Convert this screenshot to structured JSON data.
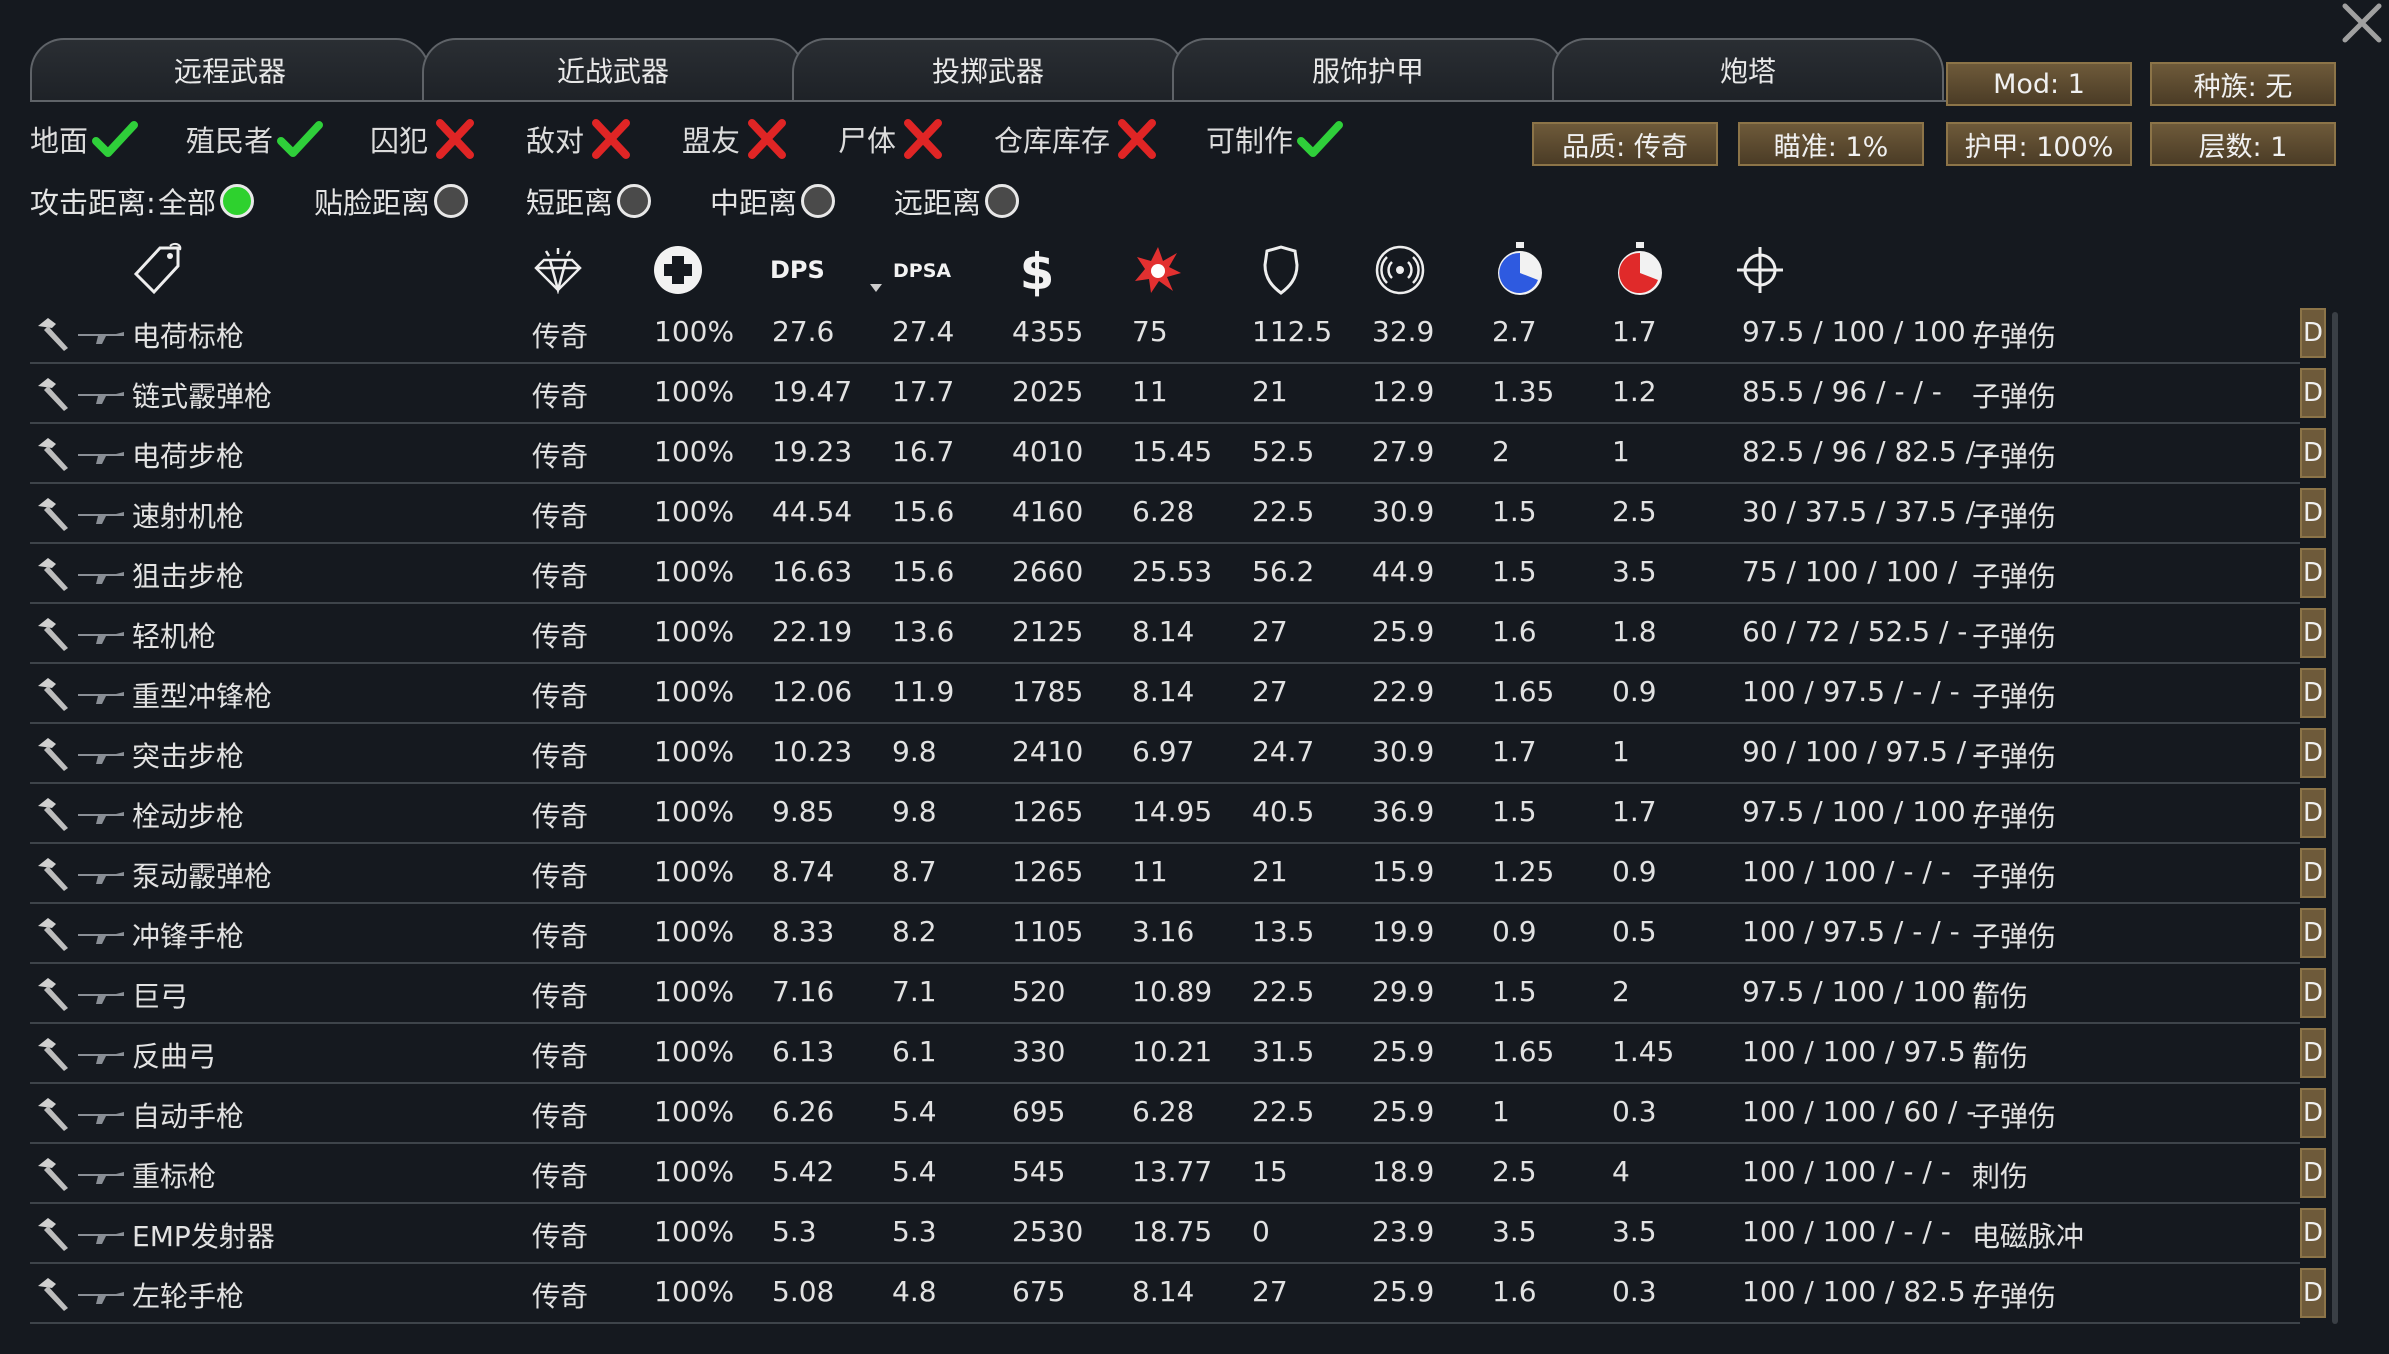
{
  "tabs": [
    "远程武器",
    "近战武器",
    "投掷武器",
    "服饰护甲",
    "炮塔"
  ],
  "right_buttons": {
    "mod": "Mod: 1",
    "race": "种族: 无",
    "quality": "品质: 传奇",
    "aim": "瞄准: 1%",
    "armor": "护甲: 100%",
    "layers": "层数: 1"
  },
  "filters": [
    {
      "label": "地面",
      "state": "check"
    },
    {
      "label": "殖民者",
      "state": "check"
    },
    {
      "label": "囚犯",
      "state": "cross"
    },
    {
      "label": "敌对",
      "state": "cross"
    },
    {
      "label": "盟友",
      "state": "cross"
    },
    {
      "label": "尸体",
      "state": "cross"
    },
    {
      "label": "仓库库存",
      "state": "cross"
    },
    {
      "label": "可制作",
      "state": "check"
    }
  ],
  "range_filter": {
    "prefix": "攻击距离:",
    "options": [
      {
        "label": "全部",
        "on": true
      },
      {
        "label": "贴脸距离",
        "on": false
      },
      {
        "label": "短距离",
        "on": false
      },
      {
        "label": "中距离",
        "on": false
      },
      {
        "label": "远距离",
        "on": false
      }
    ]
  },
  "header": {
    "dps": "DPS",
    "dpsa": "DPSA",
    "icons": [
      "tag-icon",
      "diamond-icon",
      "health-cross-icon",
      "dollar-icon",
      "explosion-icon",
      "shield-icon",
      "range-signal-icon",
      "warmup-timer-icon",
      "cooldown-timer-icon",
      "crosshair-icon"
    ]
  },
  "colors": {
    "check": "#2fcf3a",
    "cross": "#e02525",
    "button": "#6e5a3a"
  },
  "rows": [
    [
      "电荷标枪",
      "传奇",
      "100%",
      "27.6",
      "27.4",
      "4355",
      "75",
      "112.5",
      "32.9",
      "2.7",
      "1.7",
      "97.5 / 100 / 100 /",
      "子弹伤"
    ],
    [
      "链式霰弹枪",
      "传奇",
      "100%",
      "19.47",
      "17.7",
      "2025",
      "11",
      "21",
      "12.9",
      "1.35",
      "1.2",
      "85.5 / 96 / - / -",
      "子弹伤"
    ],
    [
      "电荷步枪",
      "传奇",
      "100%",
      "19.23",
      "16.7",
      "4010",
      "15.45",
      "52.5",
      "27.9",
      "2",
      "1",
      "82.5 / 96 / 82.5 / -",
      "子弹伤"
    ],
    [
      "速射机枪",
      "传奇",
      "100%",
      "44.54",
      "15.6",
      "4160",
      "6.28",
      "22.5",
      "30.9",
      "1.5",
      "2.5",
      "30 / 37.5 / 37.5 / -",
      "子弹伤"
    ],
    [
      "狙击步枪",
      "传奇",
      "100%",
      "16.63",
      "15.6",
      "2660",
      "25.53",
      "56.2",
      "44.9",
      "1.5",
      "3.5",
      "75 / 100 / 100 /",
      "子弹伤"
    ],
    [
      "轻机枪",
      "传奇",
      "100%",
      "22.19",
      "13.6",
      "2125",
      "8.14",
      "27",
      "25.9",
      "1.6",
      "1.8",
      "60 / 72 / 52.5 / -",
      "子弹伤"
    ],
    [
      "重型冲锋枪",
      "传奇",
      "100%",
      "12.06",
      "11.9",
      "1785",
      "8.14",
      "27",
      "22.9",
      "1.65",
      "0.9",
      "100 / 97.5 / - / -",
      "子弹伤"
    ],
    [
      "突击步枪",
      "传奇",
      "100%",
      "10.23",
      "9.8",
      "2410",
      "6.97",
      "24.7",
      "30.9",
      "1.7",
      "1",
      "90 / 100 / 97.5 / -",
      "子弹伤"
    ],
    [
      "栓动步枪",
      "传奇",
      "100%",
      "9.85",
      "9.8",
      "1265",
      "14.95",
      "40.5",
      "36.9",
      "1.5",
      "1.7",
      "97.5 / 100 / 100 /",
      "子弹伤"
    ],
    [
      "泵动霰弹枪",
      "传奇",
      "100%",
      "8.74",
      "8.7",
      "1265",
      "11",
      "21",
      "15.9",
      "1.25",
      "0.9",
      "100 / 100 / - / -",
      "子弹伤"
    ],
    [
      "冲锋手枪",
      "传奇",
      "100%",
      "8.33",
      "8.2",
      "1105",
      "3.16",
      "13.5",
      "19.9",
      "0.9",
      "0.5",
      "100 / 97.5 / - / -",
      "子弹伤"
    ],
    [
      "巨弓",
      "传奇",
      "100%",
      "7.16",
      "7.1",
      "520",
      "10.89",
      "22.5",
      "29.9",
      "1.5",
      "2",
      "97.5 / 100 / 100 /",
      "箭伤"
    ],
    [
      "反曲弓",
      "传奇",
      "100%",
      "6.13",
      "6.1",
      "330",
      "10.21",
      "31.5",
      "25.9",
      "1.65",
      "1.45",
      "100 / 100 / 97.5 /",
      "箭伤"
    ],
    [
      "自动手枪",
      "传奇",
      "100%",
      "6.26",
      "5.4",
      "695",
      "6.28",
      "22.5",
      "25.9",
      "1",
      "0.3",
      "100 / 100 / 60 / -",
      "子弹伤"
    ],
    [
      "重标枪",
      "传奇",
      "100%",
      "5.42",
      "5.4",
      "545",
      "13.77",
      "15",
      "18.9",
      "2.5",
      "4",
      "100 / 100 / - / -",
      "刺伤"
    ],
    [
      "EMP发射器",
      "传奇",
      "100%",
      "5.3",
      "5.3",
      "2530",
      "18.75",
      "0",
      "23.9",
      "3.5",
      "3.5",
      "100 / 100 / - / -",
      "电磁脉冲"
    ],
    [
      "左轮手枪",
      "传奇",
      "100%",
      "5.08",
      "4.8",
      "675",
      "8.14",
      "27",
      "25.9",
      "1.6",
      "0.3",
      "100 / 100 / 82.5 /",
      "子弹伤"
    ]
  ],
  "row_button": "D"
}
